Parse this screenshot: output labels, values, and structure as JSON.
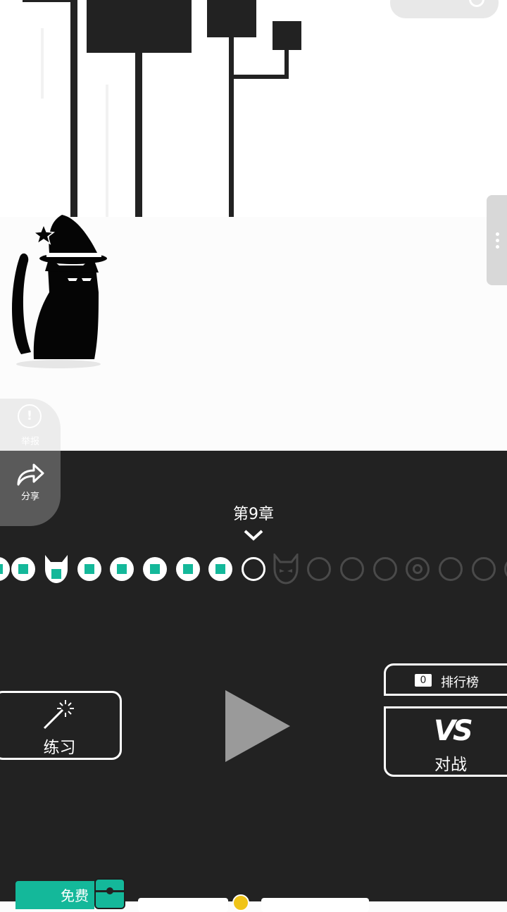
{
  "header": {
    "capsule_more_icon": "more-dots-icon",
    "capsule_close_icon": "target-close-icon"
  },
  "scene": {
    "character": "witch-cat",
    "colors": {
      "ink": "#222222",
      "sky": "#ffffff",
      "ground": "#fcfcfc"
    }
  },
  "side_actions": {
    "report_label": "举报",
    "share_label": "分享"
  },
  "chapter": {
    "label": "第9章"
  },
  "levels": [
    {
      "state": "done"
    },
    {
      "state": "done"
    },
    {
      "state": "boss_done"
    },
    {
      "state": "done"
    },
    {
      "state": "done"
    },
    {
      "state": "done"
    },
    {
      "state": "done"
    },
    {
      "state": "done"
    },
    {
      "state": "current"
    },
    {
      "state": "boss_locked"
    },
    {
      "state": "locked"
    },
    {
      "state": "locked"
    },
    {
      "state": "locked"
    },
    {
      "state": "ring_locked"
    },
    {
      "state": "locked"
    },
    {
      "state": "locked"
    },
    {
      "state": "locked"
    }
  ],
  "actions": {
    "practice_label": "练习",
    "leaderboard_count": "0",
    "leaderboard_label": "排行榜",
    "vs_mark": "VS",
    "vs_label": "对战"
  },
  "bottom_bar": {
    "free_label": "免费"
  },
  "colors": {
    "accent": "#14b89a",
    "panel": "#222222",
    "locked": "#4a4a4a",
    "coin": "#f0c419"
  }
}
